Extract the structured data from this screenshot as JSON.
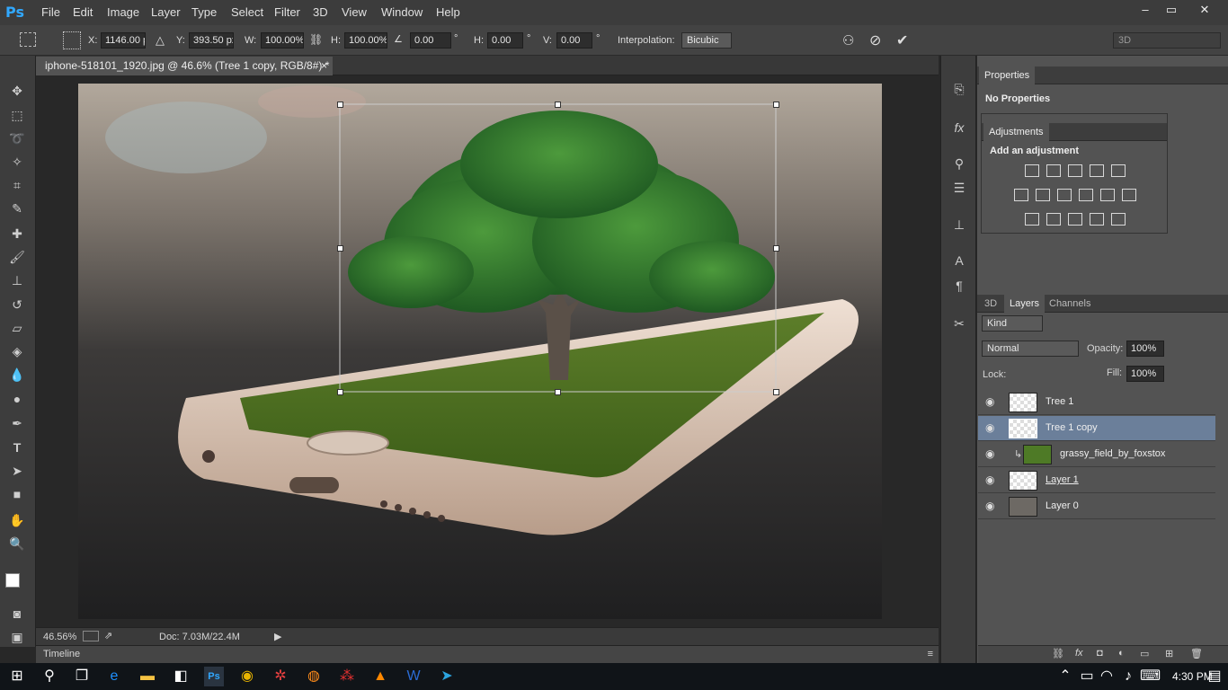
{
  "app": {
    "logo": "Ps"
  },
  "menu": [
    "File",
    "Edit",
    "Image",
    "Layer",
    "Type",
    "Select",
    "Filter",
    "3D",
    "View",
    "Window",
    "Help"
  ],
  "window_controls": {
    "minimize": "–",
    "restore": "▭",
    "close": "✕"
  },
  "options": {
    "x_label": "X:",
    "x_value": "1146.00 p:",
    "y_label": "Y:",
    "y_value": "393.50 px",
    "w_label": "W:",
    "w_value": "100.00%",
    "h_label": "H:",
    "h_value": "100.00%",
    "angle_value": "0.00",
    "deg": "°",
    "hskew_label": "H:",
    "hskew_value": "0.00",
    "vskew_label": "V:",
    "vskew_value": "0.00",
    "interp_label": "Interpolation:",
    "interp_value": "Bicubic",
    "workspace": "3D"
  },
  "document": {
    "tab": "iphone-518101_1920.jpg @ 46.6% (Tree 1 copy, RGB/8#) *",
    "close": "×"
  },
  "status": {
    "zoom": "46.56%",
    "doc": "Doc: 7.03M/22.4M"
  },
  "timeline": {
    "label": "Timeline"
  },
  "properties": {
    "tab": "Properties",
    "text": "No Properties"
  },
  "adjustments": {
    "tab": "Adjustments",
    "heading": "Add an adjustment"
  },
  "layers_panel": {
    "tabs": [
      "3D",
      "Layers",
      "Channels"
    ],
    "kind": "Kind",
    "blend": "Normal",
    "opacity_label": "Opacity:",
    "opacity_value": "100%",
    "lock_label": "Lock:",
    "fill_label": "Fill:",
    "fill_value": "100%"
  },
  "layers": [
    {
      "name": "Tree 1"
    },
    {
      "name": "Tree 1 copy"
    },
    {
      "name": "grassy_field_by_foxstox"
    },
    {
      "name": "Layer 1"
    },
    {
      "name": "Layer 0"
    }
  ],
  "taskbar": {
    "time": "4:30 PM"
  },
  "colors": {
    "accent": "#31a8ff",
    "selected_layer": "#6b7f9a",
    "panel": "#535353"
  }
}
